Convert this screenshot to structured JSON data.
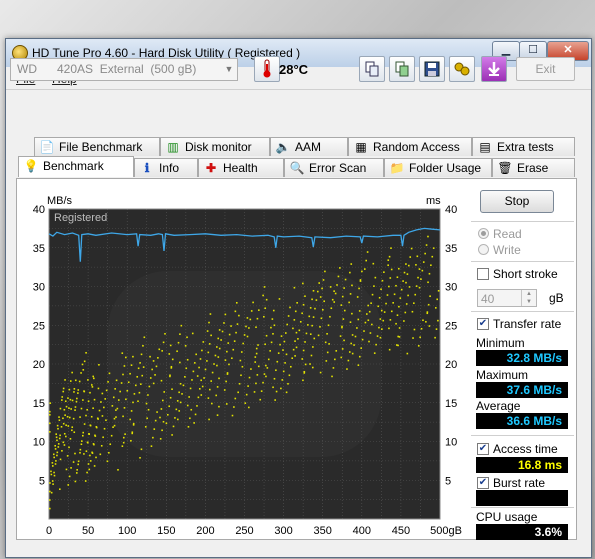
{
  "window": {
    "title": "HD Tune Pro 4.60 - Hard Disk Utility (  Registered )",
    "minimize_glyph": "▁",
    "maximize_glyph": "☐",
    "close_glyph": "✕"
  },
  "menu": [
    {
      "label": "File"
    },
    {
      "label": "Help"
    }
  ],
  "toolbar": {
    "drive_model": "WD      420AS  External  (500 gB)",
    "temperature": "28°C",
    "exit_label": "Exit",
    "icons": [
      "thermometer-icon",
      "copy-text-icon",
      "copy-screenshot-icon",
      "save-icon",
      "options-icon",
      "download-icon"
    ]
  },
  "tabs_row1": [
    {
      "label": "File Benchmark",
      "icon": "file-benchmark-icon",
      "glyph": "📄"
    },
    {
      "label": "Disk monitor",
      "icon": "disk-monitor-icon",
      "glyph": "📊"
    },
    {
      "label": "AAM",
      "icon": "speaker-icon",
      "glyph": "🔊"
    },
    {
      "label": "Random Access",
      "icon": "random-access-icon",
      "glyph": "▦"
    },
    {
      "label": "Extra tests",
      "icon": "extra-tests-icon",
      "glyph": "▤"
    }
  ],
  "tabs_row2": [
    {
      "label": "Benchmark",
      "icon": "benchmark-icon",
      "glyph": "💡",
      "active": true
    },
    {
      "label": "Info",
      "icon": "info-icon",
      "glyph": "ℹ"
    },
    {
      "label": "Health",
      "icon": "health-icon",
      "glyph": "✚"
    },
    {
      "label": "Error Scan",
      "icon": "error-scan-icon",
      "glyph": "🔍"
    },
    {
      "label": "Folder Usage",
      "icon": "folder-icon",
      "glyph": "📁"
    },
    {
      "label": "Erase",
      "icon": "erase-icon",
      "glyph": "🗑"
    }
  ],
  "side": {
    "stop_label": "Stop",
    "read_label": "Read",
    "write_label": "Write",
    "short_stroke_label": "Short stroke",
    "short_stroke_value": "40",
    "short_stroke_unit": "gB",
    "transfer_rate_label": "Transfer rate",
    "minimum_label": "Minimum",
    "minimum_value": "32.8 MB/s",
    "maximum_label": "Maximum",
    "maximum_value": "37.6 MB/s",
    "average_label": "Average",
    "average_value": "36.6 MB/s",
    "access_time_label": "Access time",
    "access_time_value": "16.8 ms",
    "burst_rate_label": "Burst rate",
    "burst_rate_value": "",
    "cpu_usage_label": "CPU usage",
    "cpu_usage_value": "3.6%",
    "colors": {
      "value_blue": "#1ec8ff",
      "value_yellow": "#ffff00",
      "value_white": "#ffffff"
    }
  },
  "chart_data": {
    "type": "line",
    "watermark": "Registered",
    "ylabel_left": "MB/s",
    "ylabel_right": "ms",
    "xlabel": "gB",
    "x_ticks": [
      "0",
      "50",
      "100",
      "150",
      "200",
      "250",
      "300",
      "350",
      "400",
      "450",
      "500gB"
    ],
    "y_ticks_left": [
      "40",
      "35",
      "30",
      "25",
      "20",
      "15",
      "10",
      "5"
    ],
    "y_ticks_right": [
      "40",
      "35",
      "30",
      "25",
      "20",
      "15",
      "10",
      "5"
    ],
    "xlim": [
      0,
      500
    ],
    "ylim": [
      0,
      40
    ],
    "grid": true,
    "background_color": "#2a2a2a",
    "transfer_color": "#3ea7e8",
    "access_color": "#e3e300",
    "transfer_series": {
      "name": "Transfer rate",
      "x": [
        0,
        5,
        10,
        20,
        30,
        38,
        40,
        42,
        50,
        60,
        80,
        100,
        112,
        114,
        116,
        130,
        140,
        145,
        147,
        149,
        160,
        180,
        200,
        220,
        240,
        260,
        280,
        288,
        290,
        292,
        300,
        320,
        336,
        338,
        340,
        360,
        380,
        398,
        400,
        402,
        420,
        440,
        450,
        452,
        454,
        460,
        470,
        480,
        490,
        500
      ],
      "y": [
        36.8,
        36.5,
        37.0,
        36.7,
        36.9,
        36.6,
        33.2,
        36.7,
        36.8,
        36.6,
        36.9,
        36.7,
        36.8,
        35.2,
        36.7,
        36.6,
        36.8,
        36.7,
        34.6,
        36.8,
        36.6,
        36.7,
        36.8,
        36.6,
        36.7,
        36.5,
        36.6,
        36.4,
        35.0,
        36.5,
        36.4,
        36.5,
        36.3,
        35.1,
        36.4,
        36.3,
        36.5,
        36.4,
        35.6,
        36.5,
        36.4,
        36.6,
        36.6,
        35.2,
        36.6,
        37.0,
        37.3,
        37.5,
        37.4,
        37.3
      ]
    },
    "access_series": {
      "name": "Access time",
      "x": [
        2,
        6,
        10,
        15,
        20,
        25,
        30,
        35,
        40,
        45,
        50,
        55,
        60,
        70,
        80,
        90,
        100,
        110,
        120,
        130,
        140,
        150,
        160,
        170,
        180,
        190,
        200,
        210,
        220,
        230,
        240,
        250,
        260,
        270,
        280,
        290,
        300,
        310,
        320,
        330,
        340,
        350,
        360,
        370,
        380,
        390,
        400,
        410,
        420,
        430,
        440,
        450,
        460,
        470,
        480,
        490
      ],
      "y": [
        7.5,
        9.0,
        10.5,
        12.0,
        10.0,
        13.5,
        11.0,
        12.5,
        14.0,
        10.5,
        15.5,
        12.0,
        13.0,
        14.5,
        12.5,
        16.0,
        15.0,
        13.5,
        17.5,
        15.0,
        16.5,
        18.5,
        17.0,
        19.0,
        17.5,
        18.0,
        20.5,
        19.0,
        21.0,
        19.5,
        22.5,
        20.0,
        22.0,
        21.0,
        24.0,
        21.5,
        23.0,
        22.5,
        25.0,
        23.5,
        24.5,
        26.0,
        24.0,
        27.0,
        25.5,
        27.5,
        26.0,
        28.5,
        27.0,
        29.0,
        28.0,
        27.5,
        29.5,
        28.5,
        30.5,
        29.0
      ]
    }
  }
}
